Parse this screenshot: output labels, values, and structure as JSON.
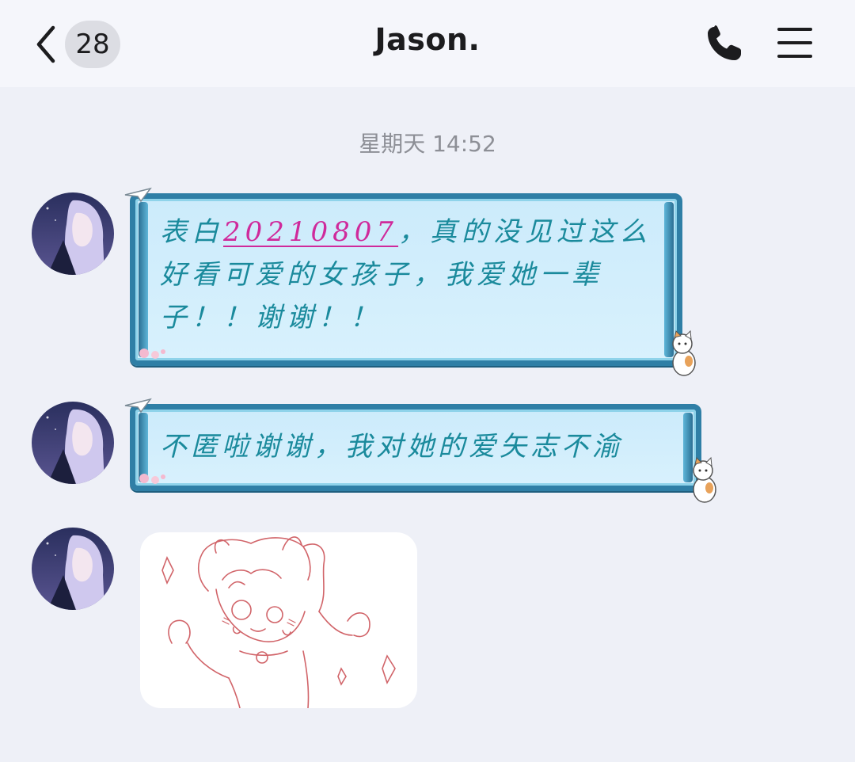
{
  "header": {
    "back_label": "back",
    "unread_count": "28",
    "title": "Jason.",
    "icons": {
      "back": "chevron-left-icon",
      "call": "phone-icon",
      "menu": "hamburger-menu-icon"
    }
  },
  "conversation": {
    "timestamp": "星期天 14:52",
    "messages": [
      {
        "type": "text",
        "pre": "表白",
        "link": "20210807",
        "post": "，真的没见过这么好看可爱的女孩子，我爱她一辈子！！谢谢！！"
      },
      {
        "type": "text",
        "text": "不匿啦谢谢，我对她的爱矢志不渝"
      },
      {
        "type": "image",
        "image_desc": "sketch-drawing"
      }
    ]
  },
  "colors": {
    "background": "#eef0f7",
    "header": "#f5f6fb",
    "bubble_frame": "#2f7fa6",
    "bubble_fill": "#d5effc",
    "bubble_text": "#1a8a9c",
    "link": "#cf2a9b",
    "unread_pill": "#dcdde3",
    "timestamp": "#8d8f96"
  }
}
